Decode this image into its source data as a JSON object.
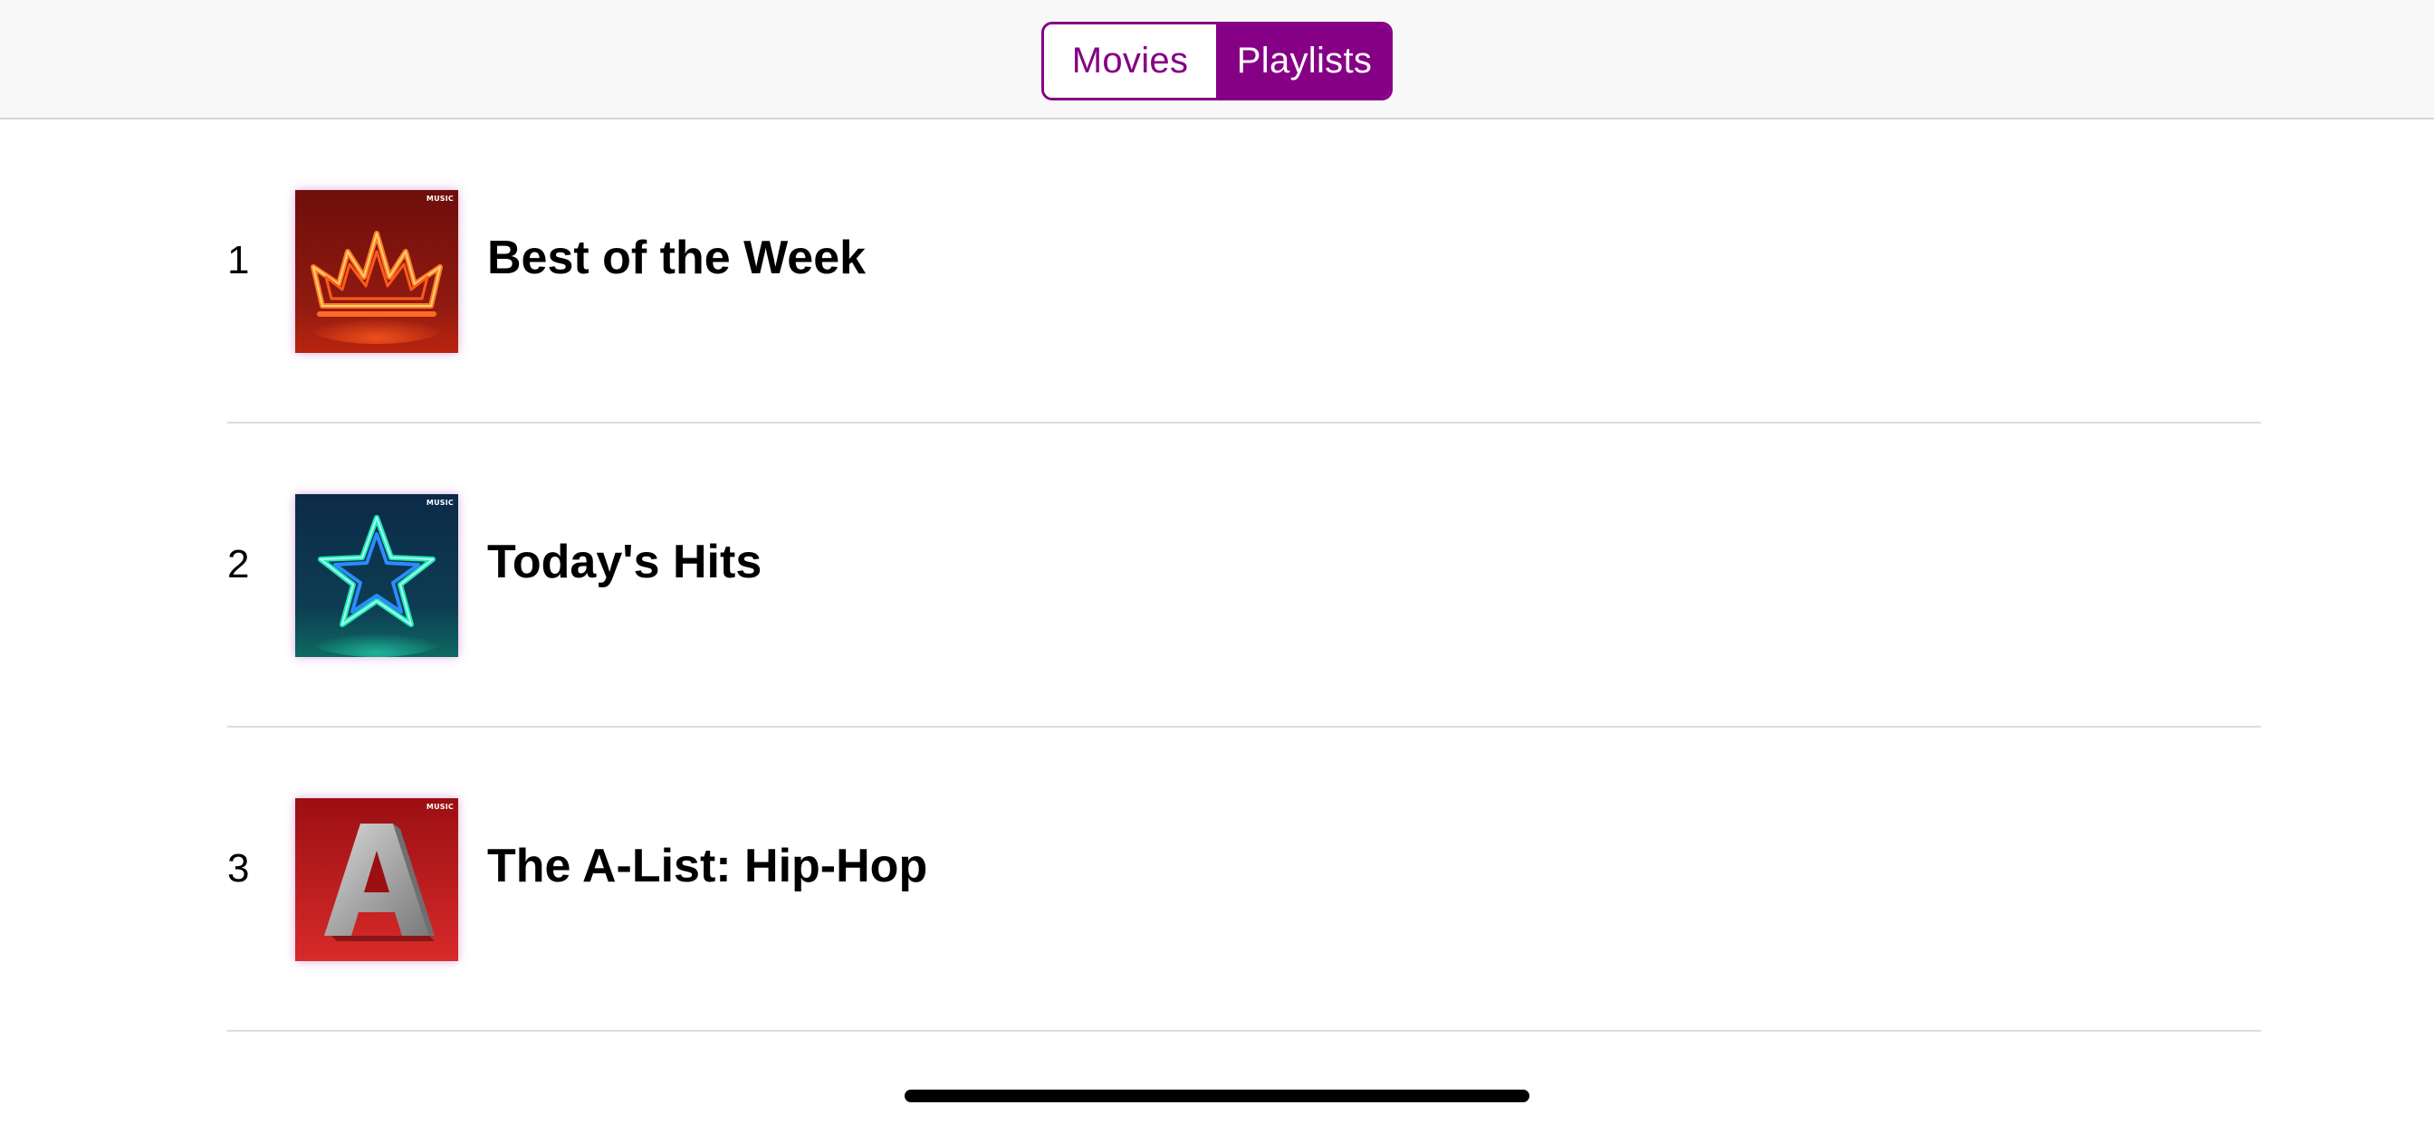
{
  "segmented_control": {
    "movies_label": "Movies",
    "playlists_label": "Playlists",
    "selected": "Playlists"
  },
  "playlists": [
    {
      "rank": "1",
      "title": "Best of the Week",
      "art_icon": "neon-crown-icon",
      "badge": "MUSIC"
    },
    {
      "rank": "2",
      "title": "Today's Hits",
      "art_icon": "neon-star-icon",
      "badge": "MUSIC"
    },
    {
      "rank": "3",
      "title": "The A-List: Hip-Hop",
      "art_icon": "stone-letter-a-icon",
      "badge": "MUSIC"
    }
  ],
  "colors": {
    "accent": "#850085",
    "topbar_background": "#f8f8f8",
    "separator": "#dcdcdc"
  }
}
